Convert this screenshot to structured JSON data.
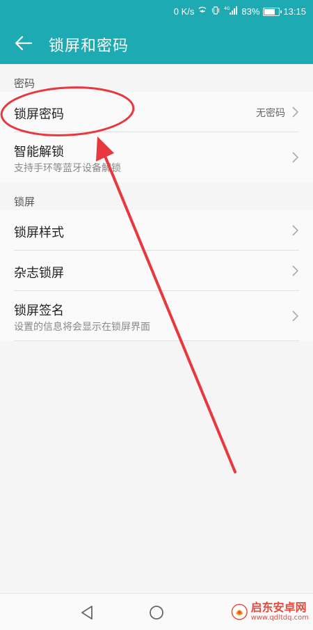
{
  "status_bar": {
    "speed": "0 K/s",
    "battery_percent": "83%",
    "battery_level": 0.83,
    "time": "13:15",
    "network": "4G"
  },
  "toolbar": {
    "title": "锁屏和密码",
    "back_icon": "arrow-left-icon"
  },
  "sections": [
    {
      "header": "密码",
      "rows": [
        {
          "title": "锁屏密码",
          "value": "无密码"
        },
        {
          "title": "智能解锁",
          "subtitle": "支持手环等蓝牙设备解锁"
        }
      ]
    },
    {
      "header": "锁屏",
      "rows": [
        {
          "title": "锁屏样式"
        },
        {
          "title": "杂志锁屏"
        },
        {
          "title": "锁屏签名",
          "subtitle": "设置的信息将会显示在锁屏界面"
        }
      ]
    }
  ],
  "watermark": {
    "name": "启东安卓网",
    "url": "www.qdltdq.com"
  },
  "colors": {
    "accent": "#1eaab3",
    "annotation": "#e8383d"
  }
}
